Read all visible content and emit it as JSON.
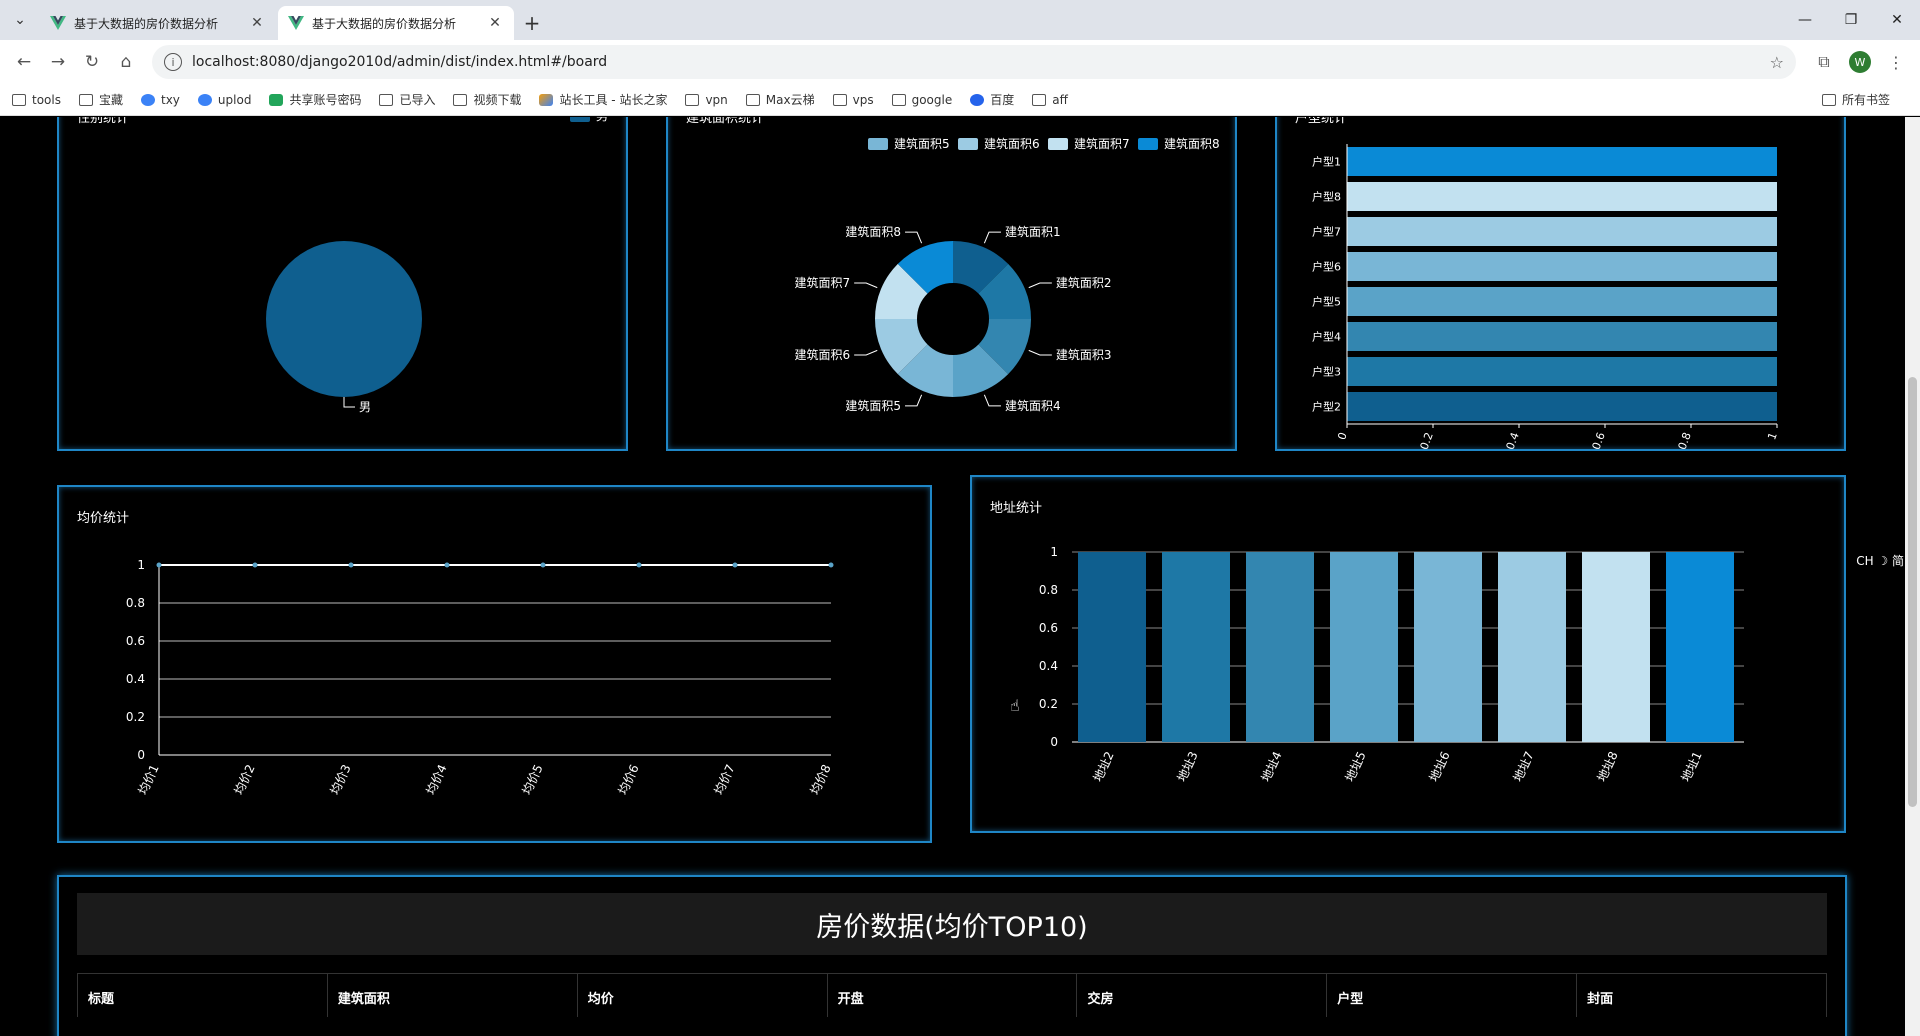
{
  "browser": {
    "tabs": [
      {
        "title": "基于大数据的房价数据分析",
        "active": false
      },
      {
        "title": "基于大数据的房价数据分析",
        "active": true
      }
    ],
    "url": "localhost:8080/django2010d/admin/dist/index.html#/board",
    "profile_initial": "W",
    "bookmarks": [
      "tools",
      "宝藏",
      "txy",
      "uplod",
      "共享账号密码",
      "已导入",
      "视频下载",
      "站长工具 - 站长之家",
      "vpn",
      "Max云梯",
      "vps",
      "google",
      "百度",
      "aff"
    ],
    "bookmarks_right": "所有书签"
  },
  "panels": {
    "gender": {
      "title": "性别统计",
      "legend": [
        "男"
      ],
      "label": "男"
    },
    "area": {
      "title": "建筑面积统计",
      "legend": [
        "建筑面积1",
        "建筑面积2",
        "建筑面积3",
        "建筑面积4",
        "建筑面积5",
        "建筑面积6",
        "建筑面积7",
        "建筑面积8"
      ]
    },
    "huxing": {
      "title": "户型统计"
    },
    "price": {
      "title": "均价统计"
    },
    "address": {
      "title": "地址统计"
    }
  },
  "table": {
    "title": "房价数据(均价TOP10)",
    "columns": [
      "标题",
      "建筑面积",
      "均价",
      "开盘",
      "交房",
      "户型",
      "封面"
    ]
  },
  "ime": "CH ☽ 简",
  "colors": {
    "border": "#1f86c6",
    "palette": [
      "#0f5f8f",
      "#1e78a6",
      "#3386b0",
      "#5aa3c8",
      "#79b6d6",
      "#9ccbe3",
      "#c2e1f0",
      "#0a8ad6"
    ]
  },
  "chart_data": [
    {
      "type": "pie",
      "title": "性别统计",
      "categories": [
        "男"
      ],
      "values": [
        1
      ]
    },
    {
      "type": "pie",
      "title": "建筑面积统计",
      "categories": [
        "建筑面积1",
        "建筑面积2",
        "建筑面积3",
        "建筑面积4",
        "建筑面积5",
        "建筑面积6",
        "建筑面积7",
        "建筑面积8"
      ],
      "values": [
        1,
        1,
        1,
        1,
        1,
        1,
        1,
        1
      ]
    },
    {
      "type": "bar",
      "orientation": "horizontal",
      "title": "户型统计",
      "categories": [
        "户型2",
        "户型3",
        "户型4",
        "户型5",
        "户型6",
        "户型7",
        "户型8",
        "户型1"
      ],
      "values": [
        1,
        1,
        1,
        1,
        1,
        1,
        1,
        1
      ],
      "xlim": [
        0,
        1
      ],
      "ticks": [
        "0",
        "0.2",
        "0.4",
        "0.6",
        "0.8",
        "1"
      ]
    },
    {
      "type": "line",
      "title": "均价统计",
      "categories": [
        "均价1",
        "均价2",
        "均价3",
        "均价4",
        "均价5",
        "均价6",
        "均价7",
        "均价8"
      ],
      "values": [
        1,
        1,
        1,
        1,
        1,
        1,
        1,
        1
      ],
      "ylim": [
        0,
        1
      ],
      "ticks": [
        "0",
        "0.2",
        "0.4",
        "0.6",
        "0.8",
        "1"
      ]
    },
    {
      "type": "bar",
      "title": "地址统计",
      "categories": [
        "地址2",
        "地址3",
        "地址4",
        "地址5",
        "地址6",
        "地址7",
        "地址8",
        "地址1"
      ],
      "values": [
        1,
        1,
        1,
        1,
        1,
        1,
        1,
        1
      ],
      "ylim": [
        0,
        1
      ],
      "ticks": [
        "0",
        "0.2",
        "0.4",
        "0.6",
        "0.8",
        "1"
      ]
    }
  ]
}
